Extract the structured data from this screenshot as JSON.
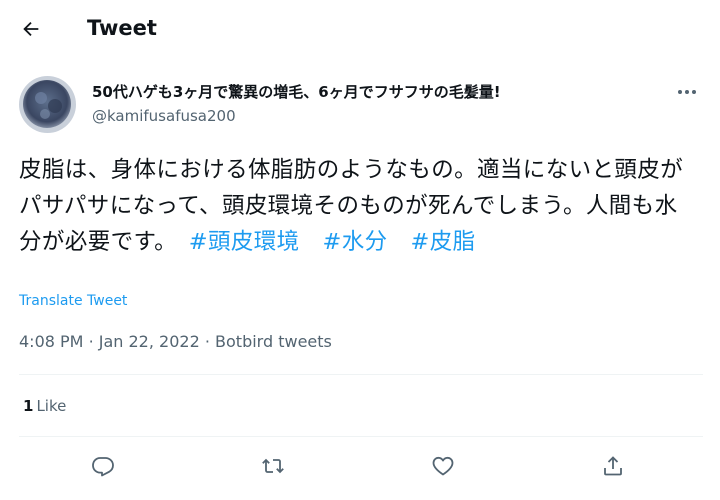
{
  "header": {
    "back_icon": "arrow-left-icon",
    "title": "Tweet"
  },
  "tweet": {
    "author": {
      "name": "50代ハゲも3ヶ月で驚異の増毛、6ヶ月でフサフサの毛髪量!",
      "handle": "@kamifusafusa200",
      "avatar_icon": "avatar-image"
    },
    "more_icon": "more-dots-icon",
    "text_main": "皮脂は、身体における体脂肪のようなもの。適当にないと頭皮がパサパサになって、頭皮環境そのものが死んでしまう。人間も水分が必要です。　",
    "hashtags": [
      "#頭皮環境",
      "#水分",
      "#皮脂"
    ],
    "translate_label": "Translate Tweet",
    "time": "4:08 PM",
    "date": "Jan 22, 2022",
    "source": "Botbird tweets",
    "separator": "·",
    "likes_count": "1",
    "likes_label": "Like"
  },
  "actions": {
    "reply_icon": "reply-icon",
    "retweet_icon": "retweet-icon",
    "like_icon": "heart-icon",
    "share_icon": "share-icon"
  },
  "colors": {
    "accent": "#1d9bf0",
    "text": "#0f1419",
    "muted": "#536471",
    "divider": "#eff3f4"
  }
}
